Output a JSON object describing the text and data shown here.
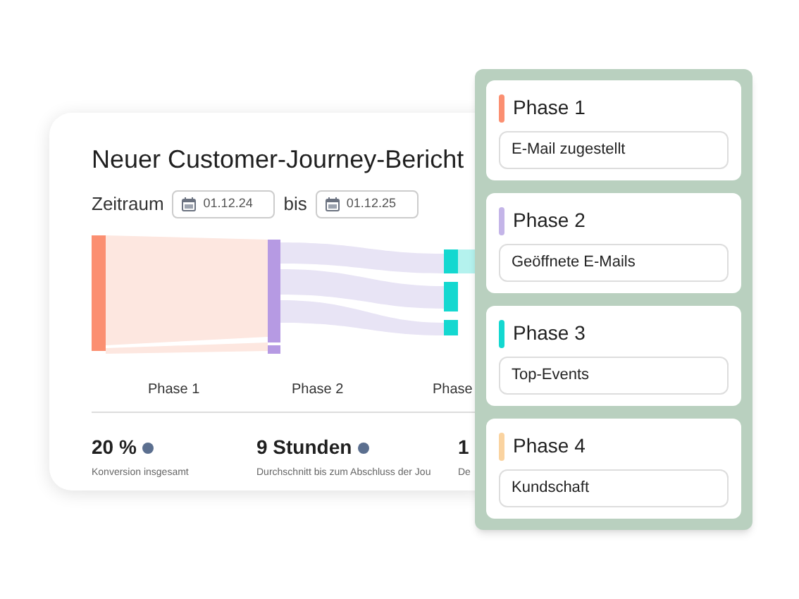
{
  "report": {
    "title": "Neuer Customer-Journey-Bericht",
    "period_label": "Zeitraum",
    "date_from": "01.12.24",
    "separator": "bis",
    "date_to": "01.12.25",
    "stage_labels": [
      "Phase 1",
      "Phase 2",
      "Phase"
    ],
    "stats": [
      {
        "value": "20 %",
        "caption": "Konversion insgesamt",
        "dot": true
      },
      {
        "value": "9 Stunden",
        "caption": "Durchschnitt bis zum Abschluss der Jou",
        "dot": true
      },
      {
        "value": "1",
        "caption": "De",
        "dot": false
      }
    ]
  },
  "phases": [
    {
      "title": "Phase 1",
      "color": "#fb8f71",
      "value": "E-Mail zugestellt"
    },
    {
      "title": "Phase 2",
      "color": "#c4b5e8",
      "value": "Geöffnete E-Mails"
    },
    {
      "title": "Phase 3",
      "color": "#14d8d0",
      "value": "Top-Events"
    },
    {
      "title": "Phase 4",
      "color": "#fad3a0",
      "value": "Kundschaft"
    }
  ]
}
